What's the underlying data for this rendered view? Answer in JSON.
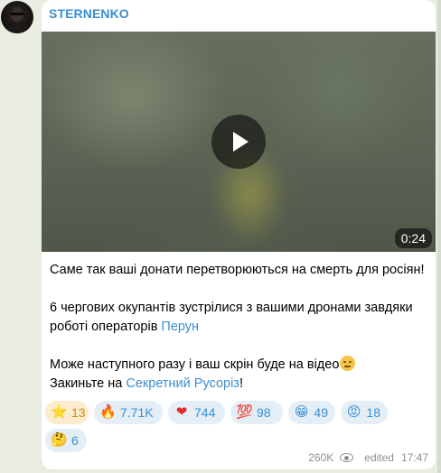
{
  "channel": {
    "name": "STERNENKO"
  },
  "video": {
    "duration": "0:24"
  },
  "message": {
    "line1": "Саме так ваші донати перетворюються на смерть для росіян!",
    "line2": "6 чергових окупантів зустрілися з вашими дронами завдяки",
    "line3_prefix": "роботі операторів ",
    "link1": "Перун",
    "line4": "Може наступного разу і ваш скрін буде на відео",
    "line5_prefix": "Закиньте на ",
    "link2": "Секретний Русоріз",
    "line5_suffix": "!"
  },
  "reactions": [
    {
      "icon": "star-icon",
      "glyph": "⭐",
      "count": "13"
    },
    {
      "icon": "fire-icon",
      "glyph": "🔥",
      "count": "7.71K"
    },
    {
      "icon": "heart-icon",
      "glyph": "❤",
      "count": "744"
    },
    {
      "icon": "hundred-icon",
      "glyph": "💯",
      "count": "98"
    },
    {
      "icon": "grin-icon",
      "glyph": "😁",
      "count": "49"
    },
    {
      "icon": "angry-face-icon",
      "glyph": "😡",
      "count": "18"
    },
    {
      "icon": "thinking-face-icon",
      "glyph": "🤔",
      "count": "6"
    }
  ],
  "meta": {
    "views": "260K",
    "edited_label": "edited",
    "time": "17:47"
  },
  "colors": {
    "accent": "#3a8ed1",
    "background": "#e8ece1",
    "star_pill": "#fbeccd"
  }
}
